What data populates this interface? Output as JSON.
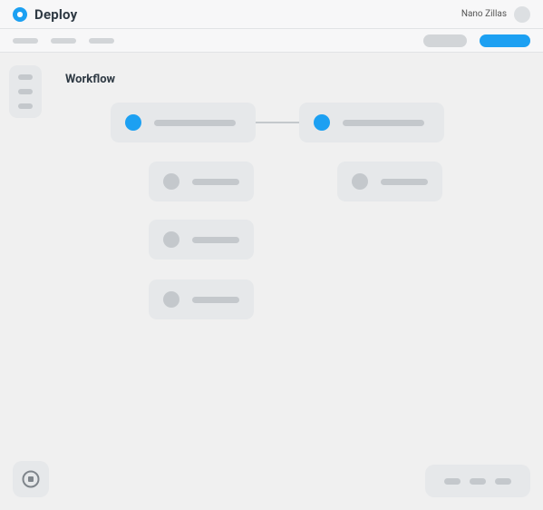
{
  "app": {
    "title": "Deploy"
  },
  "user": {
    "name": "Nano Zillas"
  },
  "page": {
    "title": "Workflow"
  },
  "colors": {
    "accent": "#1ca0f2"
  }
}
